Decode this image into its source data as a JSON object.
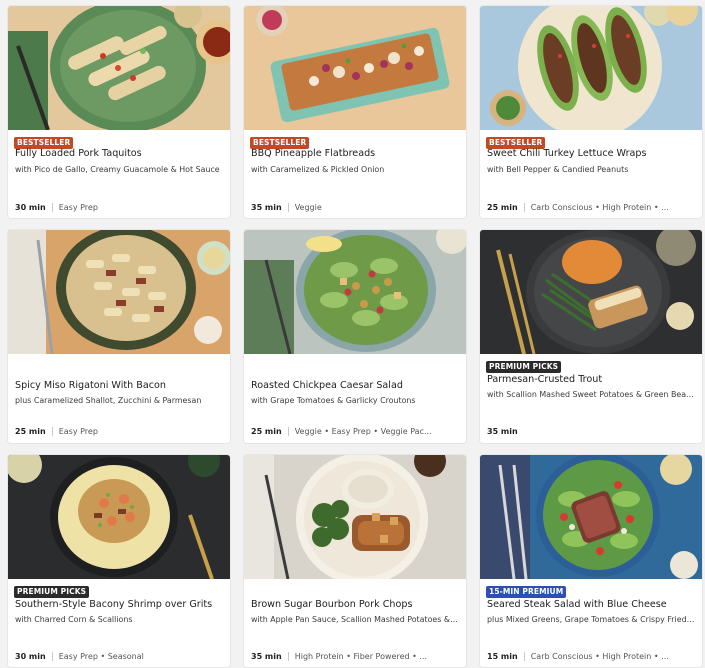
{
  "colors": {
    "bestseller": "#c04a21",
    "premium": "#2b2b2b",
    "fifteen_min": "#2d4fb5"
  },
  "recipes": [
    {
      "badge": "BESTSELLER",
      "badge_type": "bestseller",
      "title": "Fully Loaded Pork Taquitos",
      "subtitle": "with Pico de Gallo, Creamy Guacamole & Hot Sauce",
      "time": "30 min",
      "tags": "Easy Prep",
      "image": "taquitos"
    },
    {
      "badge": "BESTSELLER",
      "badge_type": "bestseller",
      "title": "BBQ Pineapple Flatbreads",
      "subtitle": "with Caramelized & Pickled Onion",
      "time": "35 min",
      "tags": "Veggie",
      "image": "flatbread"
    },
    {
      "badge": "BESTSELLER",
      "badge_type": "bestseller",
      "title": "Sweet Chili Turkey Lettuce Wraps",
      "subtitle": "with Bell Pepper & Candied Peanuts",
      "time": "25 min",
      "tags": "Carb Conscious • High Protein • ...",
      "image": "lettuce-wraps"
    },
    {
      "badge": "",
      "badge_type": "",
      "title": "Spicy Miso Rigatoni With Bacon",
      "subtitle": "plus Caramelized Shallot, Zucchini & Parmesan",
      "time": "25 min",
      "tags": "Easy Prep",
      "image": "rigatoni"
    },
    {
      "badge": "",
      "badge_type": "",
      "title": "Roasted Chickpea Caesar Salad",
      "subtitle": "with Grape Tomatoes & Garlicky Croutons",
      "time": "25 min",
      "tags": "Veggie • Easy Prep • Veggie Pac...",
      "image": "caesar-salad"
    },
    {
      "badge": "PREMIUM PICKS",
      "badge_type": "premium",
      "title": "Parmesan-Crusted Trout",
      "subtitle": "with Scallion Mashed Sweet Potatoes & Green Bean...",
      "time": "35 min",
      "tags": "",
      "image": "trout"
    },
    {
      "badge": "PREMIUM PICKS",
      "badge_type": "premium",
      "title": "Southern-Style Bacony Shrimp over Grits",
      "subtitle": "with Charred Corn & Scallions",
      "time": "30 min",
      "tags": "Easy Prep • Seasonal",
      "image": "shrimp-grits"
    },
    {
      "badge": "",
      "badge_type": "",
      "title": "Brown Sugar Bourbon Pork Chops",
      "subtitle": "with Apple Pan Sauce, Scallion Mashed Potatoes & B...",
      "time": "35 min",
      "tags": "High Protein • Fiber Powered • ...",
      "image": "pork-chops"
    },
    {
      "badge": "15-MIN PREMIUM",
      "badge_type": "fifteen_min",
      "title": "Seared Steak Salad with Blue Cheese",
      "subtitle": "plus Mixed Greens, Grape Tomatoes & Crispy Fried ...",
      "time": "15 min",
      "tags": "Carb Conscious • High Protein • ...",
      "image": "steak-salad"
    }
  ]
}
